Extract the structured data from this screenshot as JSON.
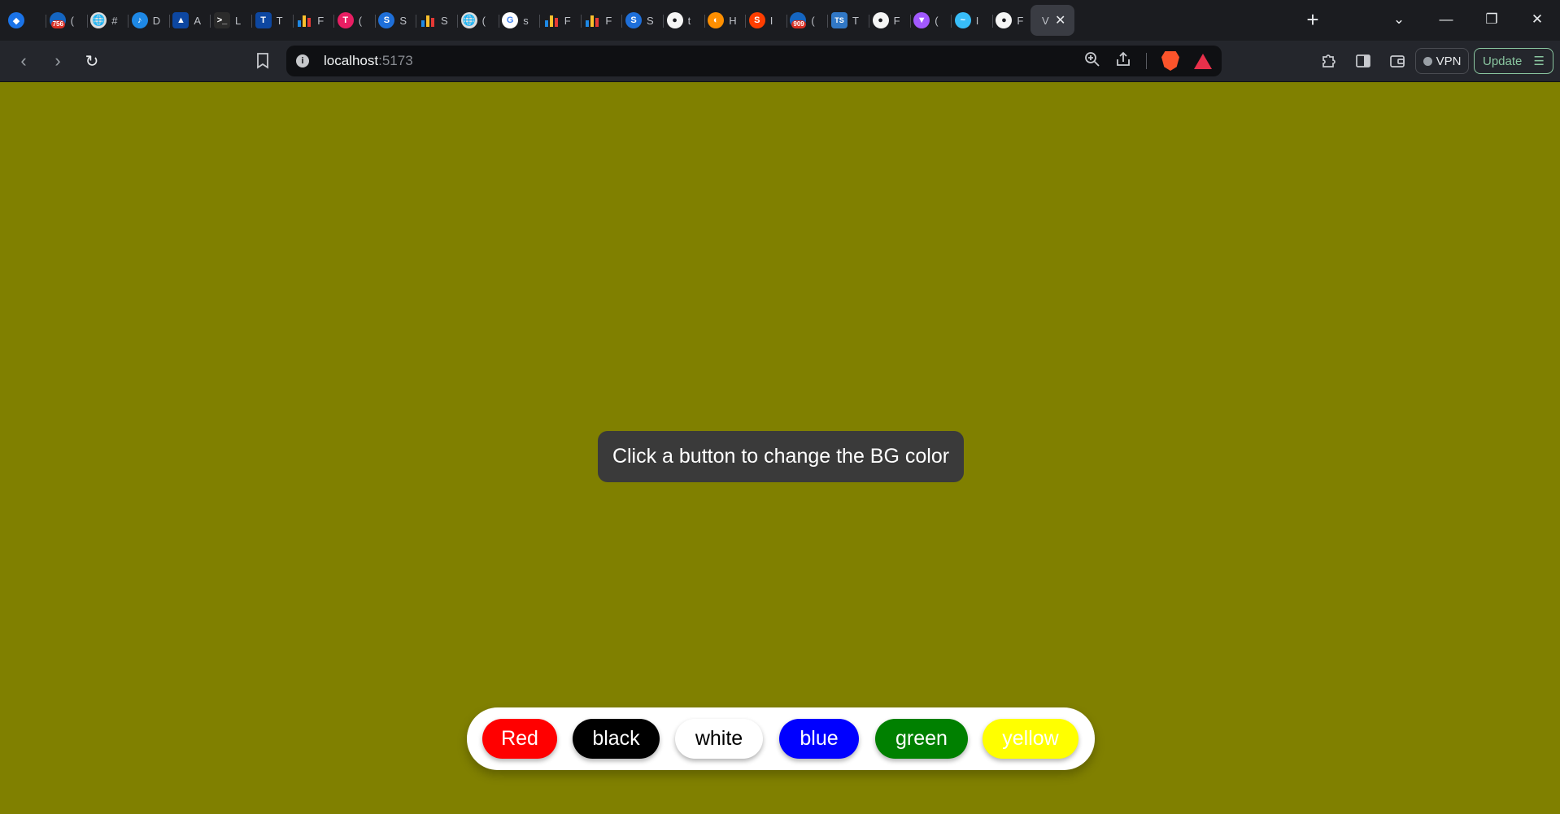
{
  "browser": {
    "tabs": [
      {
        "icon": "diamond-icon",
        "text": ""
      },
      {
        "icon": "mail-badge-icon",
        "text": "(",
        "badge": "756"
      },
      {
        "icon": "globe-icon",
        "text": "#"
      },
      {
        "icon": "music-note-icon",
        "text": "D"
      },
      {
        "icon": "triangle-app-icon",
        "text": "A"
      },
      {
        "icon": "terminal-icon",
        "text": "L"
      },
      {
        "icon": "type-icon",
        "text": "T"
      },
      {
        "icon": "bar-chart-icon",
        "text": "F"
      },
      {
        "icon": "pink-cube-icon",
        "text": "("
      },
      {
        "icon": "s-circle-icon",
        "text": "S"
      },
      {
        "icon": "bar-chart-icon",
        "text": "S"
      },
      {
        "icon": "globe-icon",
        "text": "("
      },
      {
        "icon": "google-icon",
        "text": "s"
      },
      {
        "icon": "bar-chart-icon",
        "text": "F"
      },
      {
        "icon": "bar-chart-icon",
        "text": "F"
      },
      {
        "icon": "s-circle-icon",
        "text": "S"
      },
      {
        "icon": "github-icon",
        "text": "t"
      },
      {
        "icon": "pacman-icon",
        "text": "H"
      },
      {
        "icon": "svelte-icon",
        "text": "I"
      },
      {
        "icon": "mail-badge-icon",
        "text": "(",
        "badge": "909"
      },
      {
        "icon": "typescript-icon",
        "text": "T",
        "label": "TS"
      },
      {
        "icon": "github-icon",
        "text": "F"
      },
      {
        "icon": "vite-icon",
        "text": "("
      },
      {
        "icon": "tailwind-icon",
        "text": "I"
      },
      {
        "icon": "github-icon",
        "text": "F"
      },
      {
        "icon": "none",
        "text": "V",
        "active": true
      }
    ],
    "url_host": "localhost",
    "url_port": ":5173",
    "vpn_label": "VPN",
    "update_label": "Update"
  },
  "page": {
    "background": "#808000",
    "message": "Click a button to change the BG color",
    "buttons": [
      {
        "label": "Red",
        "bg": "#ff0000",
        "fg": "#ffffff"
      },
      {
        "label": "black",
        "bg": "#000000",
        "fg": "#ffffff"
      },
      {
        "label": "white",
        "bg": "#ffffff",
        "fg": "#000000"
      },
      {
        "label": "blue",
        "bg": "#0000ff",
        "fg": "#ffffff"
      },
      {
        "label": "green",
        "bg": "#008000",
        "fg": "#ffffff"
      },
      {
        "label": "yellow",
        "bg": "#ffff00",
        "fg": "#ffffff"
      }
    ]
  }
}
